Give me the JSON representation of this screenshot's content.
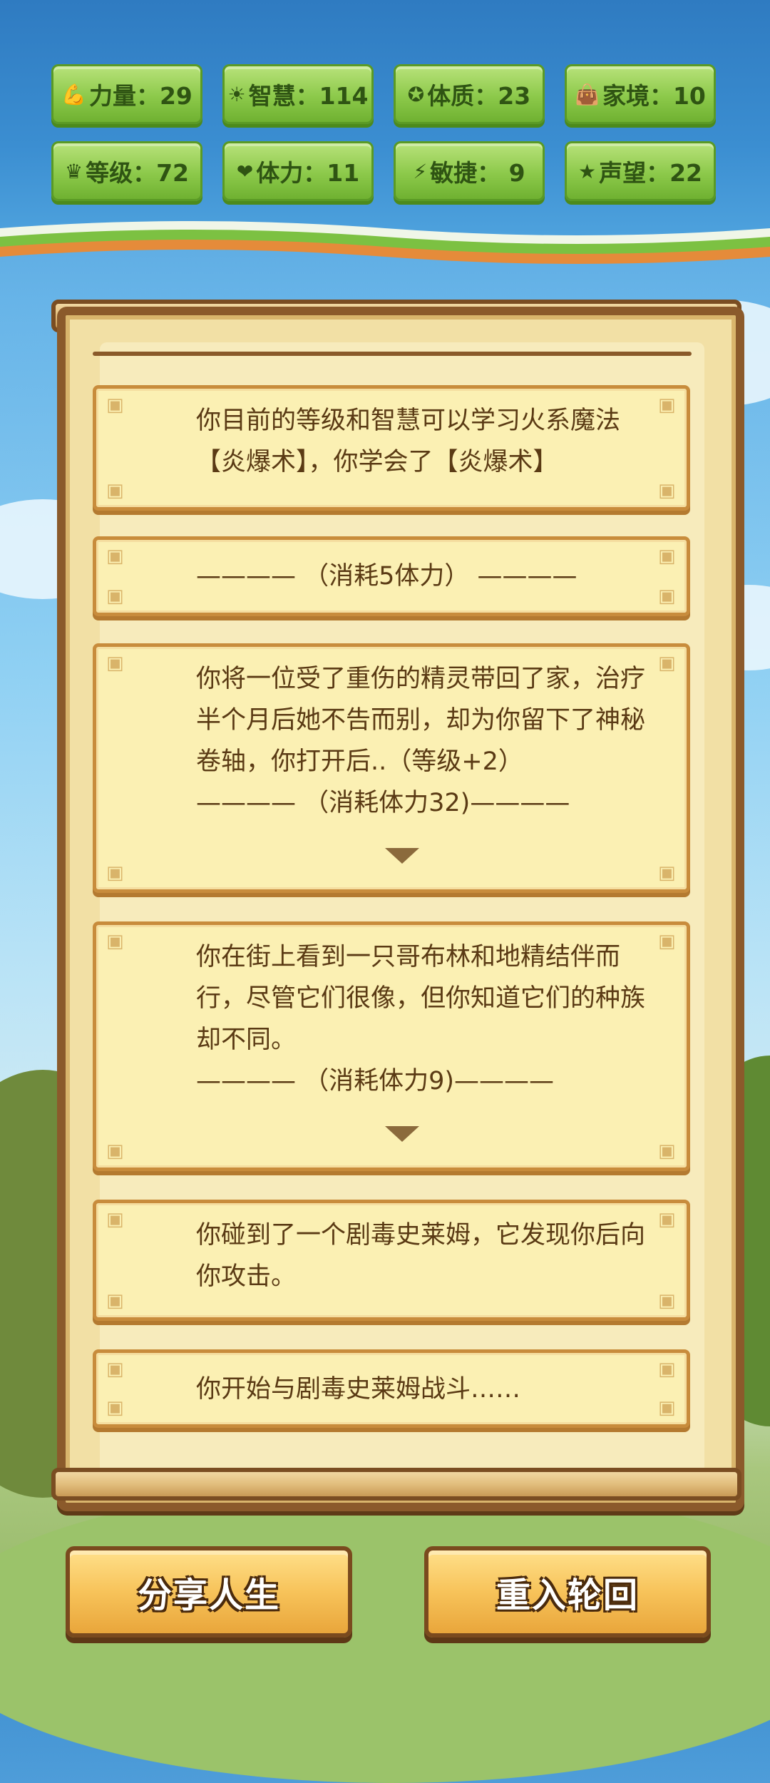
{
  "stats": [
    {
      "icon": "muscle-icon",
      "glyph": "💪",
      "text": "力量：29"
    },
    {
      "icon": "bulb-icon",
      "glyph": "☀",
      "text": "智慧：114"
    },
    {
      "icon": "body-icon",
      "glyph": "✪",
      "text": "体质：23"
    },
    {
      "icon": "money-bag-icon",
      "glyph": "👜",
      "text": "家境：10"
    },
    {
      "icon": "crown-icon",
      "glyph": "♛",
      "text": "等级：72"
    },
    {
      "icon": "heart-icon",
      "glyph": "❤",
      "text": "体力：11"
    },
    {
      "icon": "lightning-icon",
      "glyph": "⚡",
      "text": "敏捷： 9"
    },
    {
      "icon": "star-icon",
      "glyph": "★",
      "text": "声望：22"
    }
  ],
  "log": [
    {
      "text": "你目前的等级和智慧可以学习火系魔法【炎爆术】，你学会了【炎爆术】",
      "cost": ""
    },
    {
      "text": "",
      "cost": "————  （消耗5体力）  ————"
    },
    {
      "text": "你将一位受了重伤的精灵带回了家，治疗半个月后她不告而别，却为你留下了神秘卷轴，你打开后..（等级+2）",
      "cost": "————  （消耗体力32)————"
    },
    {
      "text": "你在街上看到一只哥布林和地精结伴而行，尽管它们很像，但你知道它们的种族却不同。",
      "cost": "————  （消耗体力9)————"
    },
    {
      "text": "你碰到了一个剧毒史莱姆，它发现你后向你攻击。",
      "cost": ""
    },
    {
      "text": "你开始与剧毒史莱姆战斗……",
      "cost": ""
    }
  ],
  "buttons": {
    "share": "分享人生",
    "restart": "重入轮回"
  },
  "colors": {
    "stat_green": "#8cc94a",
    "card_bg": "#fbf0b3",
    "scroll_wood": "#8b5a2b",
    "button_gold": "#f7c35a"
  }
}
